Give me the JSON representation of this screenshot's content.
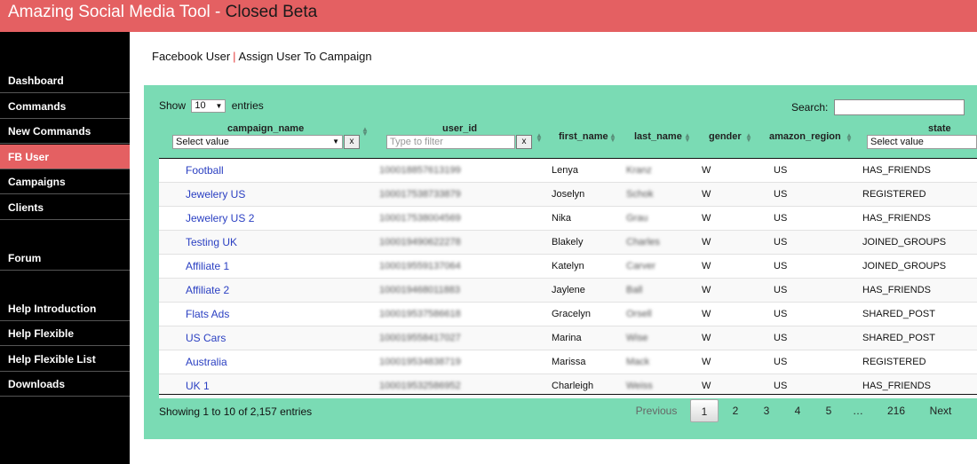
{
  "app": {
    "title": "Amazing Social Media Tool - ",
    "beta_label": "Closed Beta"
  },
  "sidebar": {
    "items": [
      {
        "label": "Dashboard",
        "active": false
      },
      {
        "label": "Commands",
        "active": false
      },
      {
        "label": "New Commands",
        "active": false
      },
      {
        "label": "FB User",
        "active": true
      },
      {
        "label": "Campaigns",
        "active": false
      },
      {
        "label": "Clients",
        "active": false
      },
      {
        "label": "Forum",
        "active": false
      },
      {
        "label": "Help Introduction",
        "active": false
      },
      {
        "label": "Help Flexible",
        "active": false
      },
      {
        "label": "Help Flexible List",
        "active": false
      },
      {
        "label": "Downloads",
        "active": false
      }
    ]
  },
  "breadcrumb": {
    "parent": "Facebook User",
    "separator": "|",
    "current": "Assign User To Campaign"
  },
  "controls": {
    "show_label": "Show",
    "entries_value": "10",
    "entries_label": "entries",
    "search_label": "Search:",
    "search_value": ""
  },
  "columns": {
    "campaign_name": "campaign_name",
    "user_id": "user_id",
    "first_name": "first_name",
    "last_name": "last_name",
    "gender": "gender",
    "amazon_region": "amazon_region",
    "state": "state"
  },
  "filters": {
    "campaign_select": "Select value",
    "user_id_placeholder": "Type to filter",
    "state_select": "Select value",
    "clear_label": "x"
  },
  "rows": [
    {
      "campaign": "Football",
      "user_id": "100018857613199",
      "first": "Lenya",
      "last": "Kranz",
      "gender": "W",
      "region": "US",
      "state": "HAS_FRIENDS"
    },
    {
      "campaign": "Jewelery US",
      "user_id": "100017538733879",
      "first": "Joselyn",
      "last": "Schok",
      "gender": "W",
      "region": "US",
      "state": "REGISTERED"
    },
    {
      "campaign": "Jewelery US 2",
      "user_id": "100017538004569",
      "first": "Nika",
      "last": "Grau",
      "gender": "W",
      "region": "US",
      "state": "HAS_FRIENDS"
    },
    {
      "campaign": "Testing UK",
      "user_id": "100019490622278",
      "first": "Blakely",
      "last": "Charles",
      "gender": "W",
      "region": "US",
      "state": "JOINED_GROUPS"
    },
    {
      "campaign": "Affiliate 1",
      "user_id": "100019559137064",
      "first": "Katelyn",
      "last": "Carver",
      "gender": "W",
      "region": "US",
      "state": "JOINED_GROUPS"
    },
    {
      "campaign": "Affiliate 2",
      "user_id": "100019468011883",
      "first": "Jaylene",
      "last": "Ball",
      "gender": "W",
      "region": "US",
      "state": "HAS_FRIENDS"
    },
    {
      "campaign": "Flats Ads",
      "user_id": "100019537586618",
      "first": "Gracelyn",
      "last": "Orsell",
      "gender": "W",
      "region": "US",
      "state": "SHARED_POST"
    },
    {
      "campaign": "US Cars",
      "user_id": "100019558417027",
      "first": "Marina",
      "last": "Wise",
      "gender": "W",
      "region": "US",
      "state": "SHARED_POST"
    },
    {
      "campaign": "Australia",
      "user_id": "100019534838719",
      "first": "Marissa",
      "last": "Mack",
      "gender": "W",
      "region": "US",
      "state": "REGISTERED"
    },
    {
      "campaign": "UK 1",
      "user_id": "100019532586952",
      "first": "Charleigh",
      "last": "Weiss",
      "gender": "W",
      "region": "US",
      "state": "HAS_FRIENDS"
    }
  ],
  "footer": {
    "showing": "Showing 1 to 10 of 2,157 entries",
    "previous": "Previous",
    "pages": [
      "1",
      "2",
      "3",
      "4",
      "5"
    ],
    "ellipsis": "…",
    "last_page": "216",
    "next": "Next"
  },
  "colors": {
    "accent": "#e46062",
    "panel": "#7adbb4",
    "link": "#2a3fc2"
  }
}
